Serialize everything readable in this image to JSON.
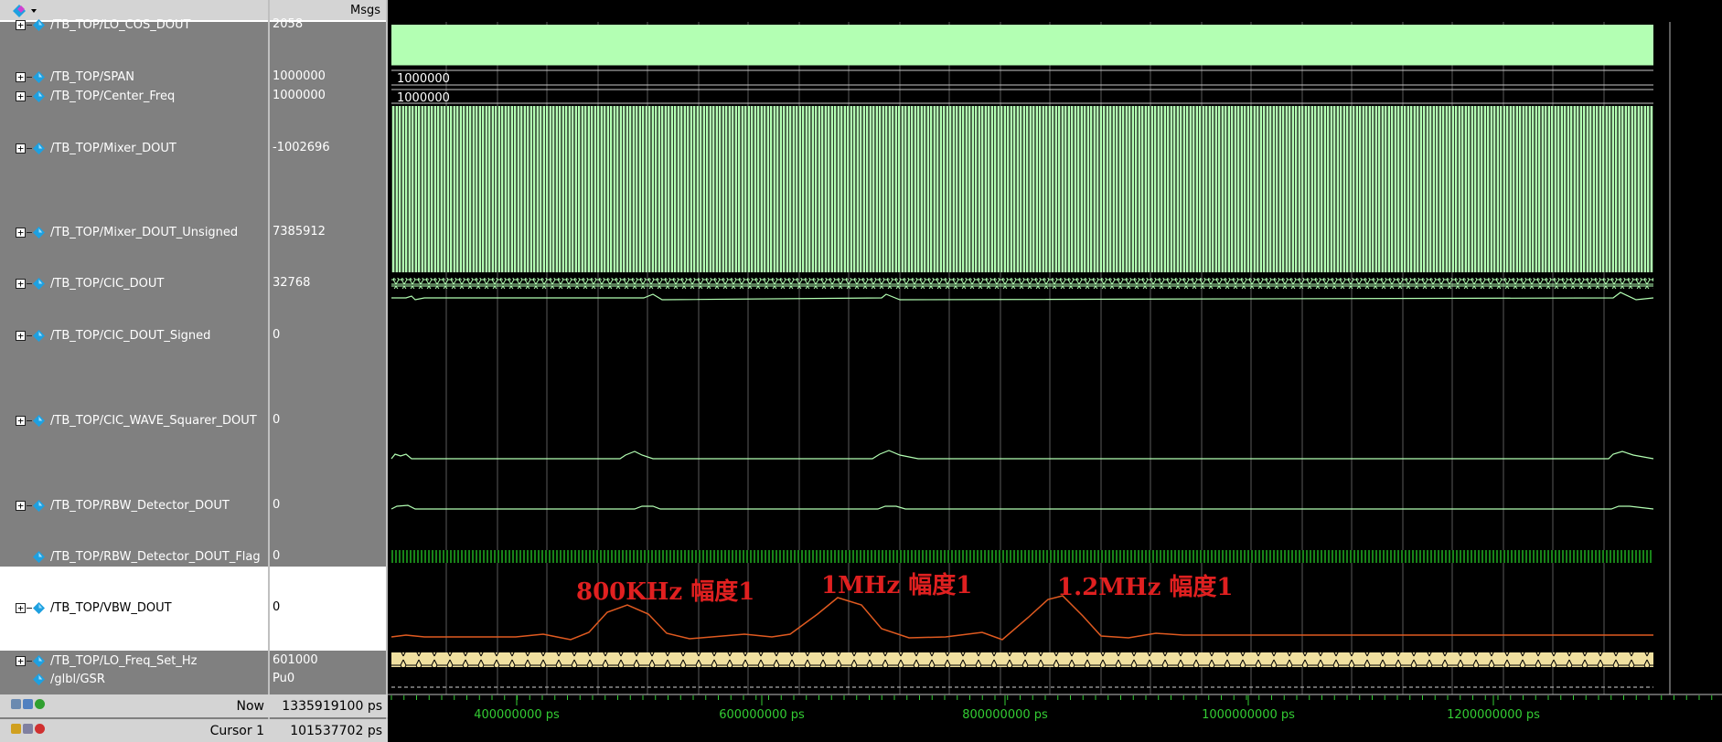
{
  "header": {
    "msgs_label": "Msgs"
  },
  "signals": [
    {
      "name": "/TB_TOP/LO_COS_DOUT",
      "value": "2058",
      "expandable": true
    },
    {
      "name": "/TB_TOP/SPAN",
      "value": "1000000",
      "expandable": true
    },
    {
      "name": "/TB_TOP/Center_Freq",
      "value": "1000000",
      "expandable": true
    },
    {
      "name": "/TB_TOP/Mixer_DOUT",
      "value": "-1002696",
      "expandable": true
    },
    {
      "name": "/TB_TOP/Mixer_DOUT_Unsigned",
      "value": "7385912",
      "expandable": true
    },
    {
      "name": "/TB_TOP/CIC_DOUT",
      "value": "32768",
      "expandable": true
    },
    {
      "name": "/TB_TOP/CIC_DOUT_Signed",
      "value": "0",
      "expandable": true
    },
    {
      "name": "/TB_TOP/CIC_WAVE_Squarer_DOUT",
      "value": "0",
      "expandable": true
    },
    {
      "name": "/TB_TOP/RBW_Detector_DOUT",
      "value": "0",
      "expandable": true
    },
    {
      "name": "/TB_TOP/RBW_Detector_DOUT_Flag",
      "value": "0",
      "expandable": false
    },
    {
      "name": "/TB_TOP/VBW_DOUT",
      "value": "0",
      "expandable": true,
      "selected": true
    },
    {
      "name": "/TB_TOP/LO_Freq_Set_Hz",
      "value": "601000",
      "expandable": true
    },
    {
      "name": "/glbl/GSR",
      "value": "Pu0",
      "expandable": false
    }
  ],
  "wave_labels": {
    "span": "1000000",
    "center_freq": "1000000"
  },
  "status": {
    "now_label": "Now",
    "now_value": "1335919100 ps",
    "cursor_label": "Cursor 1",
    "cursor_value": "101537702 ps"
  },
  "timeline": {
    "ticks": [
      "400000000 ps",
      "600000000 ps",
      "800000000 ps",
      "1000000000 ps",
      "1200000000 ps"
    ]
  },
  "annotations": [
    "800KHz 幅度1",
    "1MHz 幅度1",
    "1.2MHz 幅度1"
  ],
  "colors": {
    "wave_analog": "#b3ffb3",
    "wave_line": "#33cc33",
    "vbw_line": "#e05a20",
    "bus_yellow": "#f0e0a0",
    "timeline_text": "#33cc33",
    "annotation": "#e02020",
    "panel_grey": "#808080",
    "diamond": "#1ea0e0"
  }
}
